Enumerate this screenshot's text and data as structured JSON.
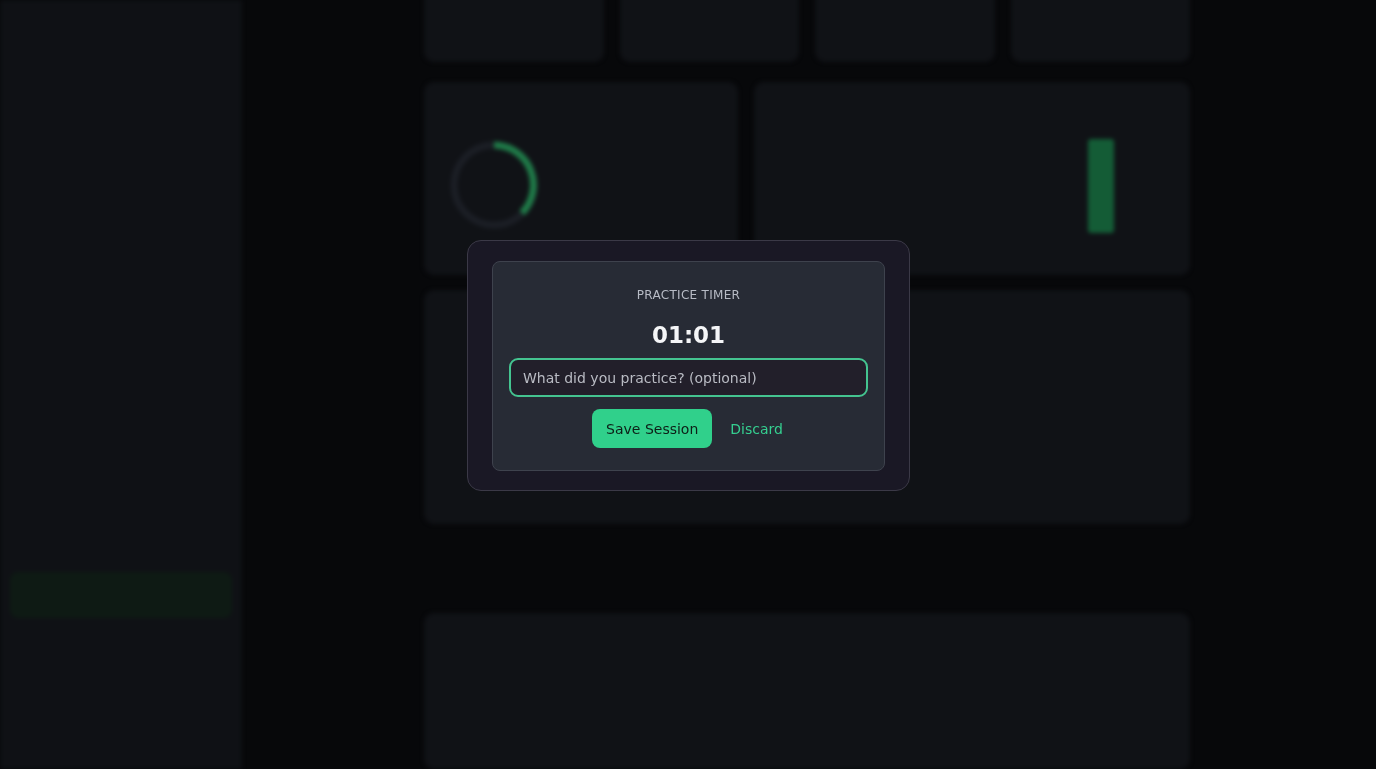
{
  "dialog": {
    "title": "PRACTICE TIMER",
    "timer": "01:01",
    "note_field": {
      "placeholder": "What did you practice? (optional)"
    },
    "buttons": [
      {
        "label": "Save Session",
        "kind": "primary"
      },
      {
        "label": "Discard",
        "kind": "link"
      }
    ]
  }
}
